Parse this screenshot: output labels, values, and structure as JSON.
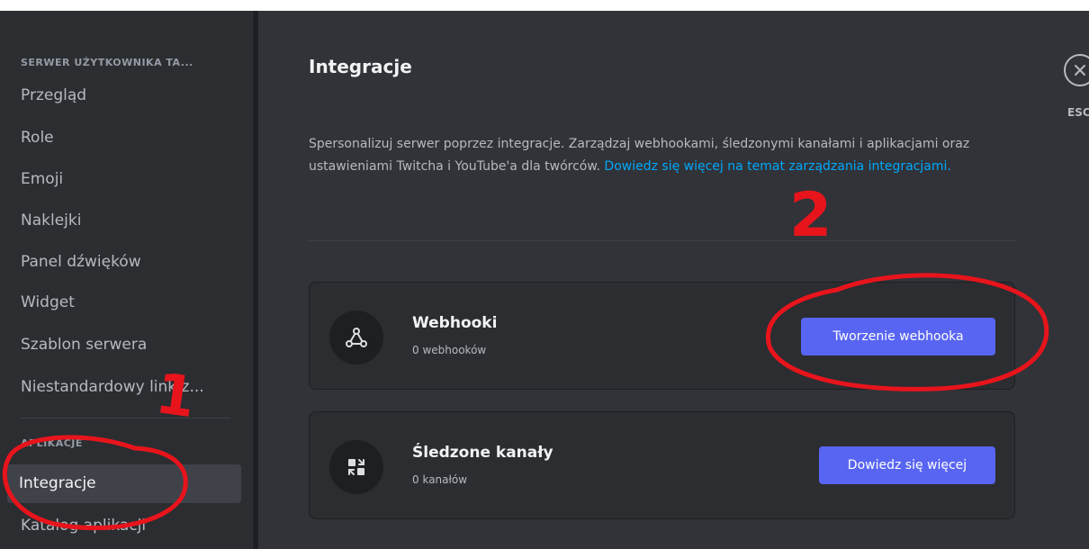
{
  "sidebar": {
    "server_header": "SERWER UŻYTKOWNIKA TA...",
    "items": [
      {
        "label": "Przegląd"
      },
      {
        "label": "Role"
      },
      {
        "label": "Emoji"
      },
      {
        "label": "Naklejki"
      },
      {
        "label": "Panel dźwięków"
      },
      {
        "label": "Widget"
      },
      {
        "label": "Szablon serwera"
      },
      {
        "label": "Niestandardowy link z..."
      }
    ],
    "apps_section_header": "APLIKACJE",
    "apps_items": [
      {
        "label": "Integracje",
        "active": true
      },
      {
        "label": "Katalog aplikacji"
      }
    ]
  },
  "main": {
    "title": "Integracje",
    "description": "Spersonalizuj serwer poprzez integracje. Zarządzaj webhookami, śledzonymi kanałami i aplikacjami oraz ustawieniami Twitcha i YouTube'a dla twórców.",
    "learn_more_link": "Dowiedz się więcej na temat zarządzania integracjami.",
    "cards": [
      {
        "title": "Webhooki",
        "subtitle": "0 webhooków",
        "button": "Tworzenie webhooka",
        "icon": "webhook-icon"
      },
      {
        "title": "Śledzone kanały",
        "subtitle": "0 kanałów",
        "button": "Dowiedz się więcej",
        "icon": "followed-channels-icon"
      }
    ]
  },
  "close": {
    "label": "ESC",
    "icon": "close-icon"
  },
  "annotations": {
    "step_one": "1",
    "step_two": "2",
    "color": "#e8141c"
  }
}
